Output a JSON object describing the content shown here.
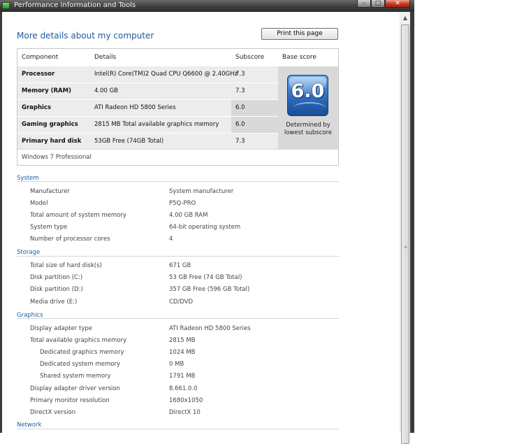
{
  "window": {
    "title": "Performance Information and Tools"
  },
  "heading": "More details about my computer",
  "print_label": "Print this page",
  "score_table": {
    "headers": {
      "component": "Component",
      "details": "Details",
      "subscore": "Subscore",
      "base": "Base score"
    },
    "rows": [
      {
        "component": "Processor",
        "details": "Intel(R) Core(TM)2 Quad CPU Q6600 @ 2.40GHz",
        "subscore": "7.3"
      },
      {
        "component": "Memory (RAM)",
        "details": "4.00 GB",
        "subscore": "7.3"
      },
      {
        "component": "Graphics",
        "details": "ATI Radeon HD 5800 Series",
        "subscore": "6.0"
      },
      {
        "component": "Gaming graphics",
        "details": "2815 MB Total available graphics memory",
        "subscore": "6.0"
      },
      {
        "component": "Primary hard disk",
        "details": "53GB Free (74GB Total)",
        "subscore": "7.3"
      }
    ],
    "base_score": "6.0",
    "base_desc": "Determined by lowest subscore",
    "os": "Windows 7 Professional"
  },
  "sections": {
    "system": {
      "title": "System",
      "items": [
        {
          "label": "Manufacturer",
          "value": "System manufacturer"
        },
        {
          "label": "Model",
          "value": "P5Q-PRO"
        },
        {
          "label": "Total amount of system memory",
          "value": "4.00 GB RAM"
        },
        {
          "label": "System type",
          "value": "64-bit operating system"
        },
        {
          "label": "Number of processor cores",
          "value": "4"
        }
      ]
    },
    "storage": {
      "title": "Storage",
      "items": [
        {
          "label": "Total size of hard disk(s)",
          "value": "671 GB"
        },
        {
          "label": "Disk partition (C:)",
          "value": "53 GB Free (74 GB Total)"
        },
        {
          "label": "Disk partition (D:)",
          "value": "357 GB Free (596 GB Total)"
        },
        {
          "label": "Media drive (E:)",
          "value": "CD/DVD"
        }
      ]
    },
    "graphics": {
      "title": "Graphics",
      "items": [
        {
          "label": "Display adapter type",
          "value": "ATI Radeon HD 5800 Series"
        },
        {
          "label": "Total available graphics memory",
          "value": "2815 MB"
        },
        {
          "label": "Dedicated graphics memory",
          "value": "1024 MB"
        },
        {
          "label": "Dedicated system memory",
          "value": "0 MB"
        },
        {
          "label": "Shared system memory",
          "value": "1791 MB"
        },
        {
          "label": "Display adapter driver version",
          "value": "8.661.0.0"
        },
        {
          "label": "Primary monitor resolution",
          "value": "1680x1050"
        },
        {
          "label": "DirectX version",
          "value": "DirectX 10"
        }
      ]
    },
    "network": {
      "title": "Network"
    }
  },
  "icons": {
    "minimize": "minimize-icon",
    "maximize": "maximize-icon",
    "close": "close-icon",
    "app": "performance-app-icon"
  }
}
